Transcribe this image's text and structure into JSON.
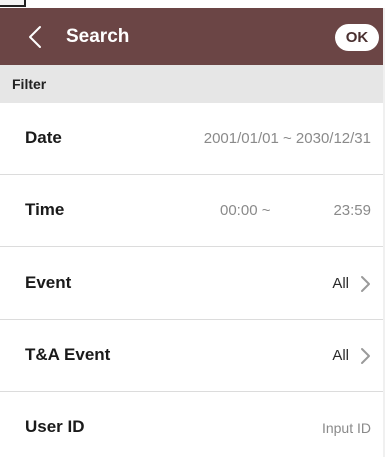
{
  "header": {
    "title": "Search",
    "ok_label": "OK",
    "background": "#6b4545",
    "back_icon": "chevron-left-icon"
  },
  "section": {
    "label": "Filter"
  },
  "rows": [
    {
      "label": "Date",
      "value": "2001/01/01 ~ 2030/12/31"
    },
    {
      "label": "Time",
      "value_start": "00:00 ~",
      "value_end": "23:59"
    },
    {
      "label": "Event",
      "value": "All",
      "icon": "chevron-right-icon"
    },
    {
      "label": "T&A Event",
      "value": "All",
      "icon": "chevron-right-icon"
    },
    {
      "label": "User ID",
      "placeholder": "Input ID"
    }
  ]
}
